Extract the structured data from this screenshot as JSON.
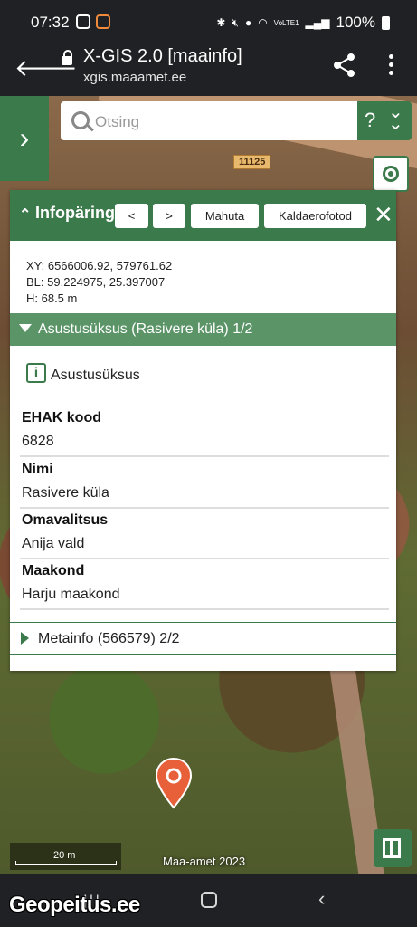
{
  "status_bar": {
    "time": "07:32",
    "battery": "100%",
    "network": "VoLTE1"
  },
  "browser": {
    "title": "X-GIS 2.0 [maainfo]",
    "url": "xgis.maaamet.ee"
  },
  "search": {
    "placeholder": "Otsing",
    "help_label": "?"
  },
  "map": {
    "road_label": "11125",
    "scale_label": "20 m",
    "attribution": "Maa-amet 2023"
  },
  "info_panel": {
    "title": "Infopäring",
    "buttons": {
      "prev": "<",
      "next": ">",
      "hide": "Mahuta",
      "oblique": "Kaldaerofotod"
    },
    "coords": {
      "xy": "XY: 6566006.92, 579761.62",
      "bl": "BL: 59.224975, 25.397007",
      "h": "H: 68.5 m"
    },
    "section1": {
      "title": "Asustusüksus (Rasivere küla) 1/2",
      "feature_type": "Asustusüksus"
    },
    "attributes": [
      {
        "label": "EHAK kood",
        "value": "6828"
      },
      {
        "label": "Nimi",
        "value": "Rasivere küla"
      },
      {
        "label": "Omavalitsus",
        "value": "Anija vald"
      },
      {
        "label": "Maakond",
        "value": "Harju maakond"
      }
    ],
    "section2": {
      "title": "Metainfo (566579) 2/2"
    }
  },
  "watermark": "Geopeitus.ee",
  "colors": {
    "accent": "#3b7a4a",
    "section": "#5a9467",
    "marker": "#e8603a"
  }
}
